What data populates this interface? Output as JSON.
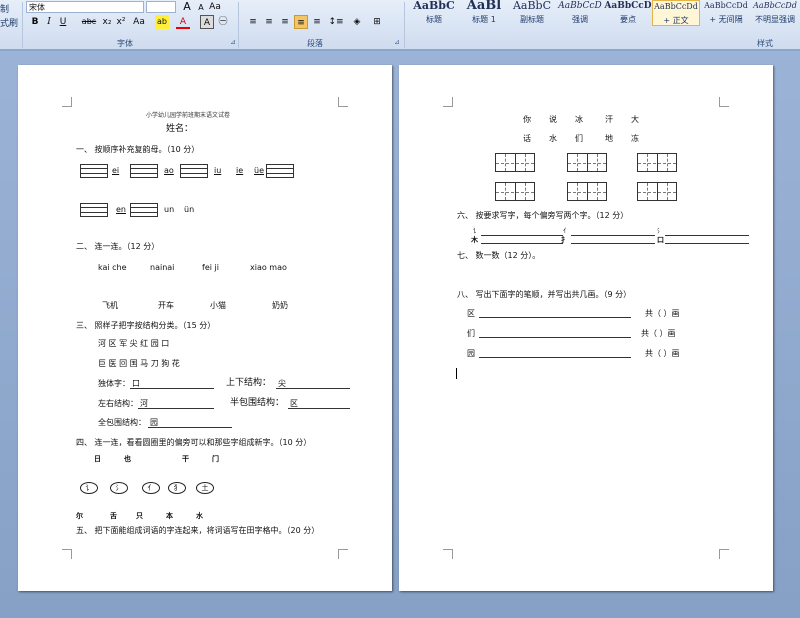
{
  "ribbon": {
    "side_labels": [
      "制",
      "式刷"
    ],
    "font_name": "宋体",
    "font_size": "",
    "font_buttons": [
      "A",
      "A",
      "Aa",
      "B",
      "I",
      "U",
      "abc",
      "x₂",
      "x²",
      "Aa",
      "ab",
      "A",
      "A",
      "㊀"
    ],
    "para_buttons": [
      "≡",
      "≡",
      "≡",
      "≡",
      "≡",
      "↕≡",
      "⊞"
    ],
    "group_font": "字体",
    "group_para": "段落",
    "group_styles": "样式",
    "styles": [
      {
        "sample": "AaBbC",
        "name": "标题"
      },
      {
        "sample": "AaBl",
        "name": "标题 1"
      },
      {
        "sample": "AaBbC",
        "name": "副标题"
      },
      {
        "sample": "AaBbCcD",
        "name": "强调"
      },
      {
        "sample": "AaBbCcD",
        "name": "要点"
      },
      {
        "sample": "AaBbCcDd",
        "name": "+ 正文"
      },
      {
        "sample": "AaBbCcDd",
        "name": "+ 无间隔"
      },
      {
        "sample": "AaBbCcDd",
        "name": "不明显强调"
      }
    ]
  },
  "page1": {
    "header": "小学幼儿园学前班期末语文试卷",
    "name_label": "姓名：",
    "q1": "一、  按顺序补充复韵母。（10 分）",
    "q1_row1": [
      "ei",
      "ao",
      "iu",
      "ie",
      "üe"
    ],
    "q1_row2": [
      "en",
      "un",
      "ün"
    ],
    "q2": "二、  连一连。（12 分）",
    "q2_pinyin": [
      "kai  che",
      "nainai",
      "fei  ji",
      "xiao  mao"
    ],
    "q2_words": [
      "飞机",
      "开车",
      "小猫",
      "奶奶"
    ],
    "q3": "三、  照样子把字按结构分类。（15 分）",
    "q3_row1": "河    区    军    尖    红    园    口",
    "q3_row2": "巨    医    回    国    马    刀    狗    花",
    "q3_c1": "独体字：",
    "q3_c1_ex": "口",
    "q3_c2": "上下结构：",
    "q3_c2_ex": "尖",
    "q3_c3": "左右结构：",
    "q3_c3_ex": "河",
    "q3_c4": "半包围结构：",
    "q3_c4_ex": "区",
    "q3_c5": "全包围结构：",
    "q3_c5_ex": "园",
    "q4": "四、  连一连，看看圆圈里的偏旁可以和那些字组成新字。（10 分）",
    "q4_top": [
      "日",
      "也",
      "干",
      "门"
    ],
    "q4_ovals": [
      "讠",
      "氵",
      "亻",
      "犭",
      "土"
    ],
    "q4_bottom": [
      "尔",
      "舌",
      "只",
      "本",
      "水"
    ],
    "q5": "五、  把下面能组成词语的字连起来，将词语写在田字格中。（20 分）"
  },
  "page2": {
    "row1": [
      "你",
      "说",
      "冰",
      "汗",
      "大"
    ],
    "row2": [
      "话",
      "水",
      "们",
      "地",
      "冻"
    ],
    "q6": "六、  按要求写字，每个偏旁写两个字。（12 分）",
    "q6_radicals": [
      "木",
      "讠",
      "扌",
      "亻",
      "氵",
      "口"
    ],
    "q7": "七、  数一数（12 分）。",
    "q8": "八、  写出下面字的笔顺，并写出共几画。（9 分）",
    "q8_chars": [
      "区",
      "们",
      "园"
    ],
    "q8_total": "共（      ）画"
  }
}
